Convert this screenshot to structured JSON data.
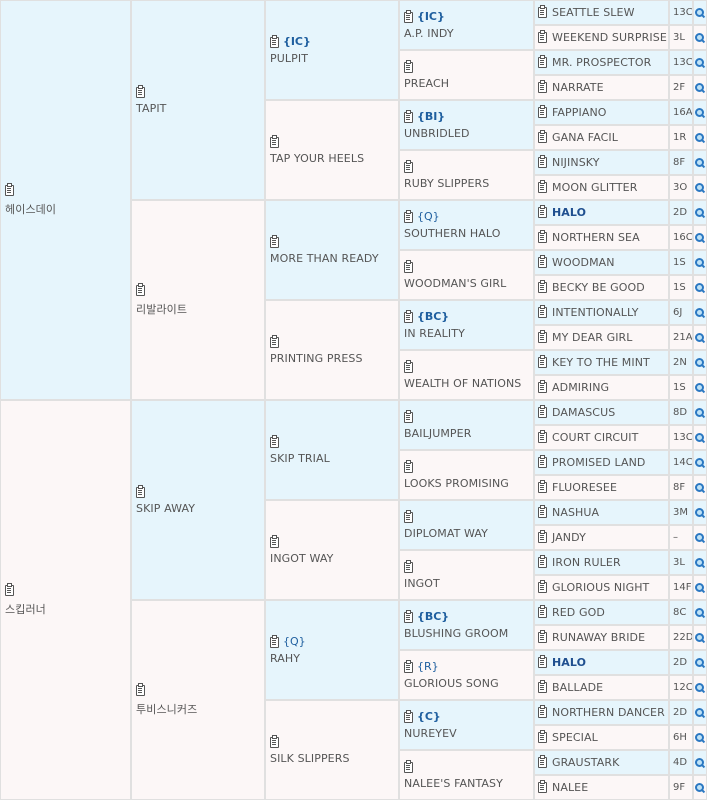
{
  "gen1": [
    {
      "name": "헤이스데이"
    },
    {
      "name": "스킵러너"
    }
  ],
  "gen2": [
    {
      "name": "TAPIT"
    },
    {
      "name": "리발라이트"
    },
    {
      "name": "SKIP AWAY"
    },
    {
      "name": "투비스니커즈"
    }
  ],
  "gen3": [
    {
      "name": "PULPIT",
      "category": "{IC}"
    },
    {
      "name": "TAP YOUR HEELS",
      "category": ""
    },
    {
      "name": "MORE THAN READY",
      "category": ""
    },
    {
      "name": "PRINTING PRESS",
      "category": ""
    },
    {
      "name": "SKIP TRIAL",
      "category": ""
    },
    {
      "name": "INGOT WAY",
      "category": ""
    },
    {
      "name": "RAHY",
      "category": "{Q}"
    },
    {
      "name": "SILK SLIPPERS",
      "category": ""
    }
  ],
  "gen4": [
    {
      "name": "A.P. INDY",
      "category": "{IC}"
    },
    {
      "name": "PREACH",
      "category": ""
    },
    {
      "name": "UNBRIDLED",
      "category": "{BI}"
    },
    {
      "name": "RUBY SLIPPERS",
      "category": ""
    },
    {
      "name": "SOUTHERN HALO",
      "category": "{Q}"
    },
    {
      "name": "WOODMAN'S GIRL",
      "category": ""
    },
    {
      "name": "IN REALITY",
      "category": "{BC}"
    },
    {
      "name": "WEALTH OF NATIONS",
      "category": ""
    },
    {
      "name": "BAILJUMPER",
      "category": ""
    },
    {
      "name": "LOOKS PROMISING",
      "category": ""
    },
    {
      "name": "DIPLOMAT WAY",
      "category": ""
    },
    {
      "name": "INGOT",
      "category": ""
    },
    {
      "name": "BLUSHING GROOM",
      "category": "{BC}"
    },
    {
      "name": "GLORIOUS SONG",
      "category": "{R}"
    },
    {
      "name": "NUREYEV",
      "category": "{C}"
    },
    {
      "name": "NALEE'S FANTASY",
      "category": ""
    }
  ],
  "gen5": [
    {
      "name": "SEATTLE SLEW",
      "code": "13C"
    },
    {
      "name": "WEEKEND SURPRISE",
      "code": "3L"
    },
    {
      "name": "MR. PROSPECTOR",
      "code": "13C"
    },
    {
      "name": "NARRATE",
      "code": "2F"
    },
    {
      "name": "FAPPIANO",
      "code": "16A"
    },
    {
      "name": "GANA FACIL",
      "code": "1R"
    },
    {
      "name": "NIJINSKY",
      "code": "8F"
    },
    {
      "name": "MOON GLITTER",
      "code": "3O"
    },
    {
      "name": "HALO",
      "code": "2D",
      "bold": true
    },
    {
      "name": "NORTHERN SEA",
      "code": "16C"
    },
    {
      "name": "WOODMAN",
      "code": "1S"
    },
    {
      "name": "BECKY BE GOOD",
      "code": "1S"
    },
    {
      "name": "INTENTIONALLY",
      "code": "6J"
    },
    {
      "name": "MY DEAR GIRL",
      "code": "21A"
    },
    {
      "name": "KEY TO THE MINT",
      "code": "2N"
    },
    {
      "name": "ADMIRING",
      "code": "1S"
    },
    {
      "name": "DAMASCUS",
      "code": "8D"
    },
    {
      "name": "COURT CIRCUIT",
      "code": "13C"
    },
    {
      "name": "PROMISED LAND",
      "code": "14C"
    },
    {
      "name": "FLUORESEE",
      "code": "8F"
    },
    {
      "name": "NASHUA",
      "code": "3M"
    },
    {
      "name": "JANDY",
      "code": "–"
    },
    {
      "name": "IRON RULER",
      "code": "3L"
    },
    {
      "name": "GLORIOUS NIGHT",
      "code": "14F"
    },
    {
      "name": "RED GOD",
      "code": "8C"
    },
    {
      "name": "RUNAWAY BRIDE",
      "code": "22D"
    },
    {
      "name": "HALO",
      "code": "2D",
      "bold": true
    },
    {
      "name": "BALLADE",
      "code": "12C"
    },
    {
      "name": "NORTHERN DANCER",
      "code": "2D"
    },
    {
      "name": "SPECIAL",
      "code": "6H"
    },
    {
      "name": "GRAUSTARK",
      "code": "4D"
    },
    {
      "name": "NALEE",
      "code": "9F"
    }
  ],
  "icons": {
    "pedigree": "clipboard-icon",
    "search": "magnifier-icon"
  },
  "colors": {
    "sire_bg": "#e6f5fc",
    "dam_bg": "#fcf7f7",
    "category": "#1f5f9f",
    "border": "#e0e0e0"
  }
}
